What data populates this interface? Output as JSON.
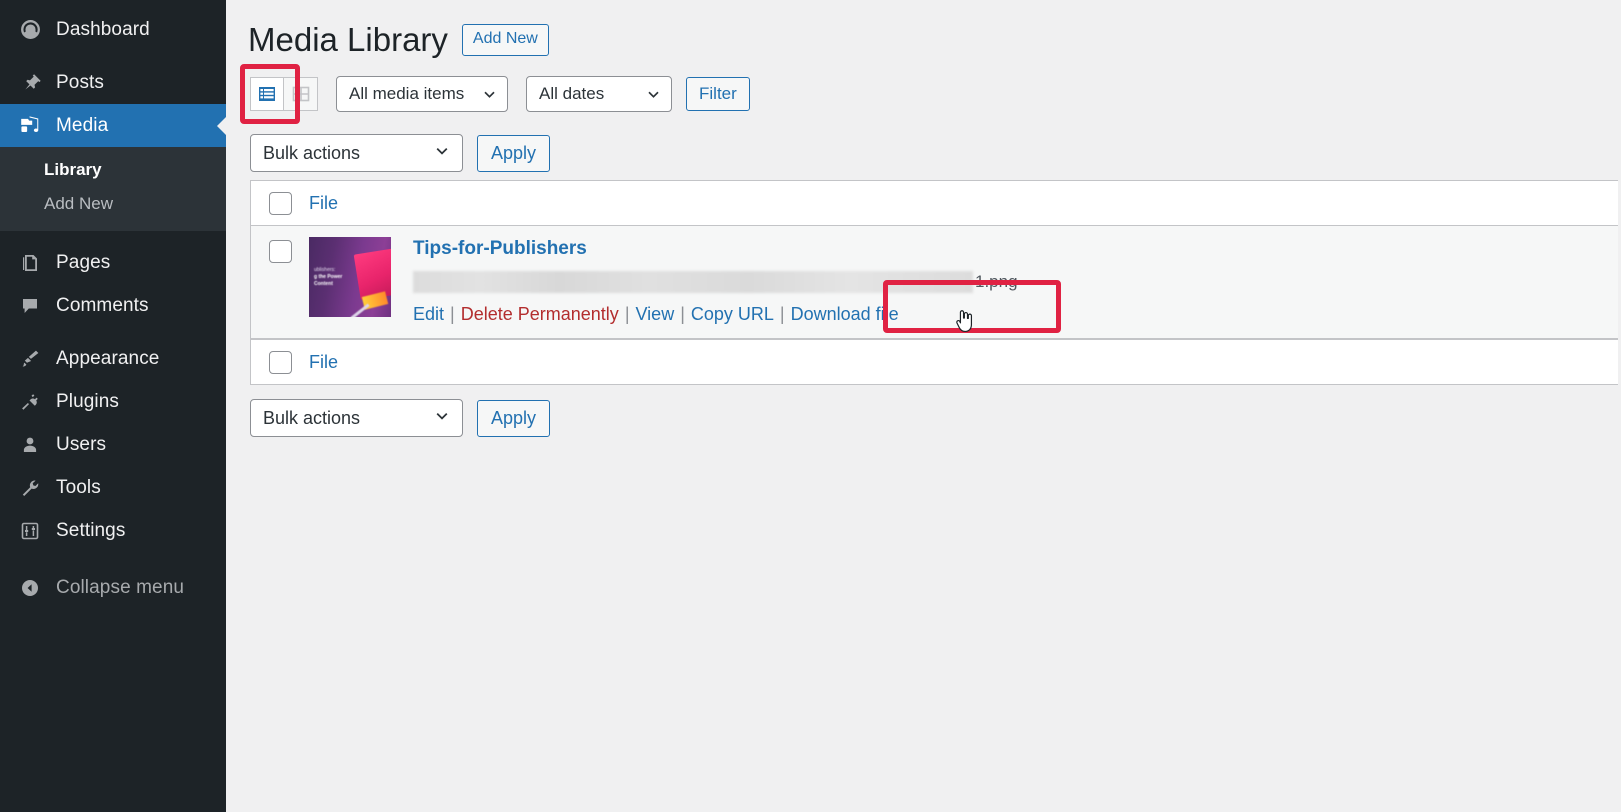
{
  "sidebar": {
    "items": [
      {
        "label": "Dashboard",
        "icon": "dashboard-icon",
        "name": "dashboard"
      },
      {
        "label": "Posts",
        "icon": "pin-icon",
        "name": "posts"
      },
      {
        "label": "Media",
        "icon": "media-icon",
        "name": "media",
        "current": true
      },
      {
        "label": "Pages",
        "icon": "pages-icon",
        "name": "pages"
      },
      {
        "label": "Comments",
        "icon": "comments-icon",
        "name": "comments"
      },
      {
        "label": "Appearance",
        "icon": "paintbrush-icon",
        "name": "appearance"
      },
      {
        "label": "Plugins",
        "icon": "plug-icon",
        "name": "plugins"
      },
      {
        "label": "Users",
        "icon": "user-icon",
        "name": "users"
      },
      {
        "label": "Tools",
        "icon": "wrench-icon",
        "name": "tools"
      },
      {
        "label": "Settings",
        "icon": "sliders-icon",
        "name": "settings"
      }
    ],
    "submenu": [
      {
        "label": "Library",
        "current": true
      },
      {
        "label": "Add New",
        "current": false
      }
    ],
    "collapse": {
      "label": "Collapse menu",
      "icon": "arrow-left-circle-icon"
    },
    "colors": {
      "background": "#1d2327",
      "submenu_background": "#2c3338",
      "current": "#2271b1"
    }
  },
  "header": {
    "title": "Media Library",
    "add_new_label": "Add New"
  },
  "toolbar": {
    "view_list_label": "List view",
    "view_grid_label": "Grid view",
    "active_view": "list",
    "media_filter": {
      "value": "All media items"
    },
    "date_filter": {
      "value": "All dates"
    },
    "filter_button": "Filter"
  },
  "bulk_top": {
    "select_value": "Bulk actions",
    "apply_label": "Apply"
  },
  "bulk_bottom": {
    "select_value": "Bulk actions",
    "apply_label": "Apply"
  },
  "table": {
    "header_column": "File",
    "footer_column": "File",
    "rows": [
      {
        "title": "Tips-for-Publishers",
        "filename_redacted": true,
        "filename_suffix": "1.png",
        "thumbnail_alt": "Tips-for-Publishers cover image",
        "thumbnail_overlay_line1": "ublishers:",
        "thumbnail_overlay_line2": "g the Power",
        "thumbnail_overlay_line3": "Content",
        "actions": [
          {
            "label": "Edit",
            "style": "link"
          },
          {
            "label": "Delete Permanently",
            "style": "danger"
          },
          {
            "label": "View",
            "style": "link"
          },
          {
            "label": "Copy URL",
            "style": "link"
          },
          {
            "label": "Download file",
            "style": "link",
            "highlighted": true
          }
        ],
        "action_separator": "|"
      }
    ]
  },
  "annotations": {
    "highlight_color": "#e02243",
    "boxes": [
      {
        "target": "list-view-button"
      },
      {
        "target": "download-file-link"
      }
    ]
  },
  "cursor": {
    "type": "pointer-hand",
    "over": "Download file"
  }
}
